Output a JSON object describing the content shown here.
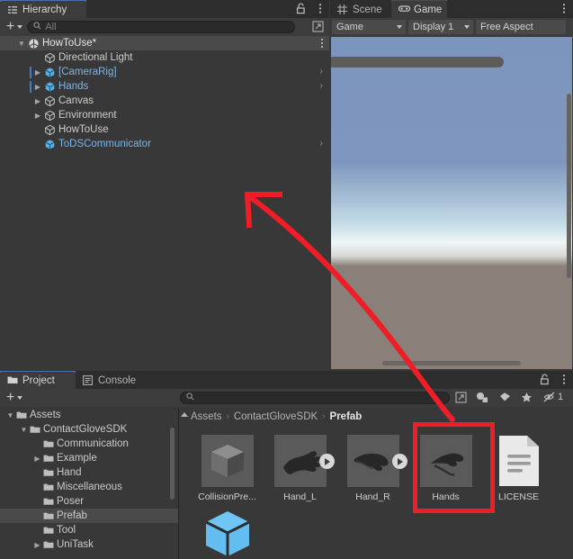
{
  "hierarchy": {
    "tab_label": "Hierarchy",
    "tab_icon": "hierarchy-icon",
    "lock_icon": "lock-icon",
    "menu_icon": "kebab-menu-icon",
    "create_label": "+",
    "search_placeholder": "All",
    "search_value": "",
    "rows": [
      {
        "label": "HowToUse*",
        "icon": "unity-scene-icon",
        "indent": 0,
        "twisty": "down",
        "type": "scene",
        "modified": false,
        "open_chevron": false
      },
      {
        "label": "Directional Light",
        "icon": "gameobject-icon",
        "indent": 1,
        "twisty": "none",
        "type": "gameobject",
        "modified": false,
        "open_chevron": false
      },
      {
        "label": "[CameraRig]",
        "icon": "prefab-icon",
        "indent": 1,
        "twisty": "right",
        "type": "prefab",
        "modified": true,
        "open_chevron": true
      },
      {
        "label": "Hands",
        "icon": "prefab-icon",
        "indent": 1,
        "twisty": "right",
        "type": "prefab",
        "modified": true,
        "open_chevron": true
      },
      {
        "label": "Canvas",
        "icon": "gameobject-icon",
        "indent": 1,
        "twisty": "right",
        "type": "gameobject",
        "modified": false,
        "open_chevron": false
      },
      {
        "label": "Environment",
        "icon": "gameobject-icon",
        "indent": 1,
        "twisty": "right",
        "type": "gameobject",
        "modified": false,
        "open_chevron": false
      },
      {
        "label": "HowToUse",
        "icon": "gameobject-icon",
        "indent": 1,
        "twisty": "none",
        "type": "gameobject",
        "modified": false,
        "open_chevron": false
      },
      {
        "label": "ToDSCommunicator",
        "icon": "prefab-icon",
        "indent": 1,
        "twisty": "none",
        "type": "prefab",
        "modified": false,
        "open_chevron": true
      }
    ]
  },
  "gameview": {
    "tabs": [
      {
        "label": "Scene",
        "icon": "scene-grid-icon",
        "active": false
      },
      {
        "label": "Game",
        "icon": "gamepad-icon",
        "active": true
      }
    ],
    "menu_icon": "kebab-menu-icon",
    "controls": {
      "target": "Game",
      "display": "Display 1",
      "aspect": "Free Aspect"
    }
  },
  "project": {
    "tabs": [
      {
        "label": "Project",
        "icon": "folder-icon",
        "active": true
      },
      {
        "label": "Console",
        "icon": "console-icon",
        "active": false
      }
    ],
    "lock_icon": "lock-icon",
    "menu_icon": "kebab-menu-icon",
    "create_label": "+",
    "search_placeholder": "",
    "search_value": "",
    "toolbar_icons": [
      {
        "name": "open-in-window-icon",
        "label": ""
      },
      {
        "name": "filter-by-type-icon",
        "label": ""
      },
      {
        "name": "filter-by-label-icon",
        "label": ""
      },
      {
        "name": "favorites-star-icon",
        "label": ""
      },
      {
        "name": "hidden-packages-icon",
        "label": "1"
      }
    ],
    "tree": [
      {
        "label": "Assets",
        "indent": 0,
        "twisty": "down",
        "selected": false
      },
      {
        "label": "ContactGloveSDK",
        "indent": 1,
        "twisty": "down",
        "selected": false
      },
      {
        "label": "Communication",
        "indent": 2,
        "twisty": "none",
        "selected": false
      },
      {
        "label": "Example",
        "indent": 2,
        "twisty": "right",
        "selected": false
      },
      {
        "label": "Hand",
        "indent": 2,
        "twisty": "none",
        "selected": false
      },
      {
        "label": "Miscellaneous",
        "indent": 2,
        "twisty": "none",
        "selected": false
      },
      {
        "label": "Poser",
        "indent": 2,
        "twisty": "none",
        "selected": false
      },
      {
        "label": "Prefab",
        "indent": 2,
        "twisty": "none",
        "selected": true
      },
      {
        "label": "Tool",
        "indent": 2,
        "twisty": "none",
        "selected": false
      },
      {
        "label": "UniTask",
        "indent": 2,
        "twisty": "right",
        "selected": false
      }
    ],
    "breadcrumb": [
      "Assets",
      "ContactGloveSDK",
      "Prefab"
    ],
    "assets": [
      {
        "name": "CollisionPre...",
        "thumb": "cube-mesh-thumb",
        "has_play": false,
        "highlighted": false
      },
      {
        "name": "Hand_L",
        "thumb": "hand-left-mesh-thumb",
        "has_play": true,
        "highlighted": false
      },
      {
        "name": "Hand_R",
        "thumb": "hand-right-mesh-thumb",
        "has_play": true,
        "highlighted": false
      },
      {
        "name": "Hands",
        "thumb": "hands-mesh-thumb",
        "has_play": false,
        "highlighted": true
      },
      {
        "name": "LICENSE",
        "thumb": "text-document-thumb",
        "has_play": false,
        "highlighted": false
      },
      {
        "name": "",
        "thumb": "blue-prefab-cube-thumb",
        "has_play": false,
        "highlighted": false
      }
    ]
  },
  "annotations": {
    "arrow_color": "#ef1d26",
    "highlight_color": "#ef1d26",
    "arrow_name": "drag-hands-prefab-to-hierarchy-arrow",
    "highlight_name": "hands-prefab-highlight"
  }
}
